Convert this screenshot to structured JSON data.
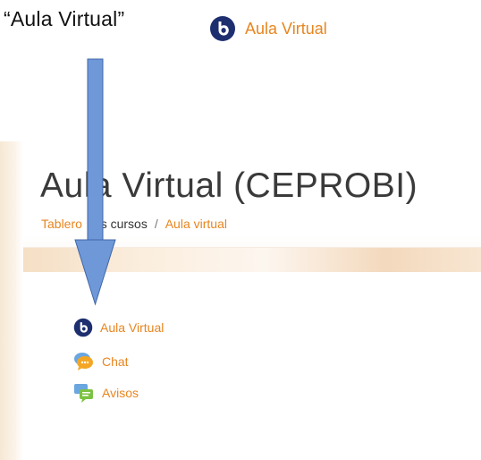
{
  "annotation": {
    "quote_title": "“Aula Virtual”",
    "top_link_label": "Aula Virtual"
  },
  "page": {
    "title": "Aula Virtual (CEPROBI)",
    "breadcrumb": {
      "item1": "Tablero",
      "item2": "Mis cursos",
      "separator": "/",
      "item3": "Aula virtual"
    },
    "activities": [
      {
        "label": "Aula Virtual",
        "icon": "bigbluebutton-icon"
      },
      {
        "label": "Chat",
        "icon": "chat-icon"
      },
      {
        "label": "Avisos",
        "icon": "forum-icon"
      }
    ]
  },
  "colors": {
    "link": "#e8851f",
    "title": "#3a3a3a",
    "arrow": "#6f98d9"
  }
}
